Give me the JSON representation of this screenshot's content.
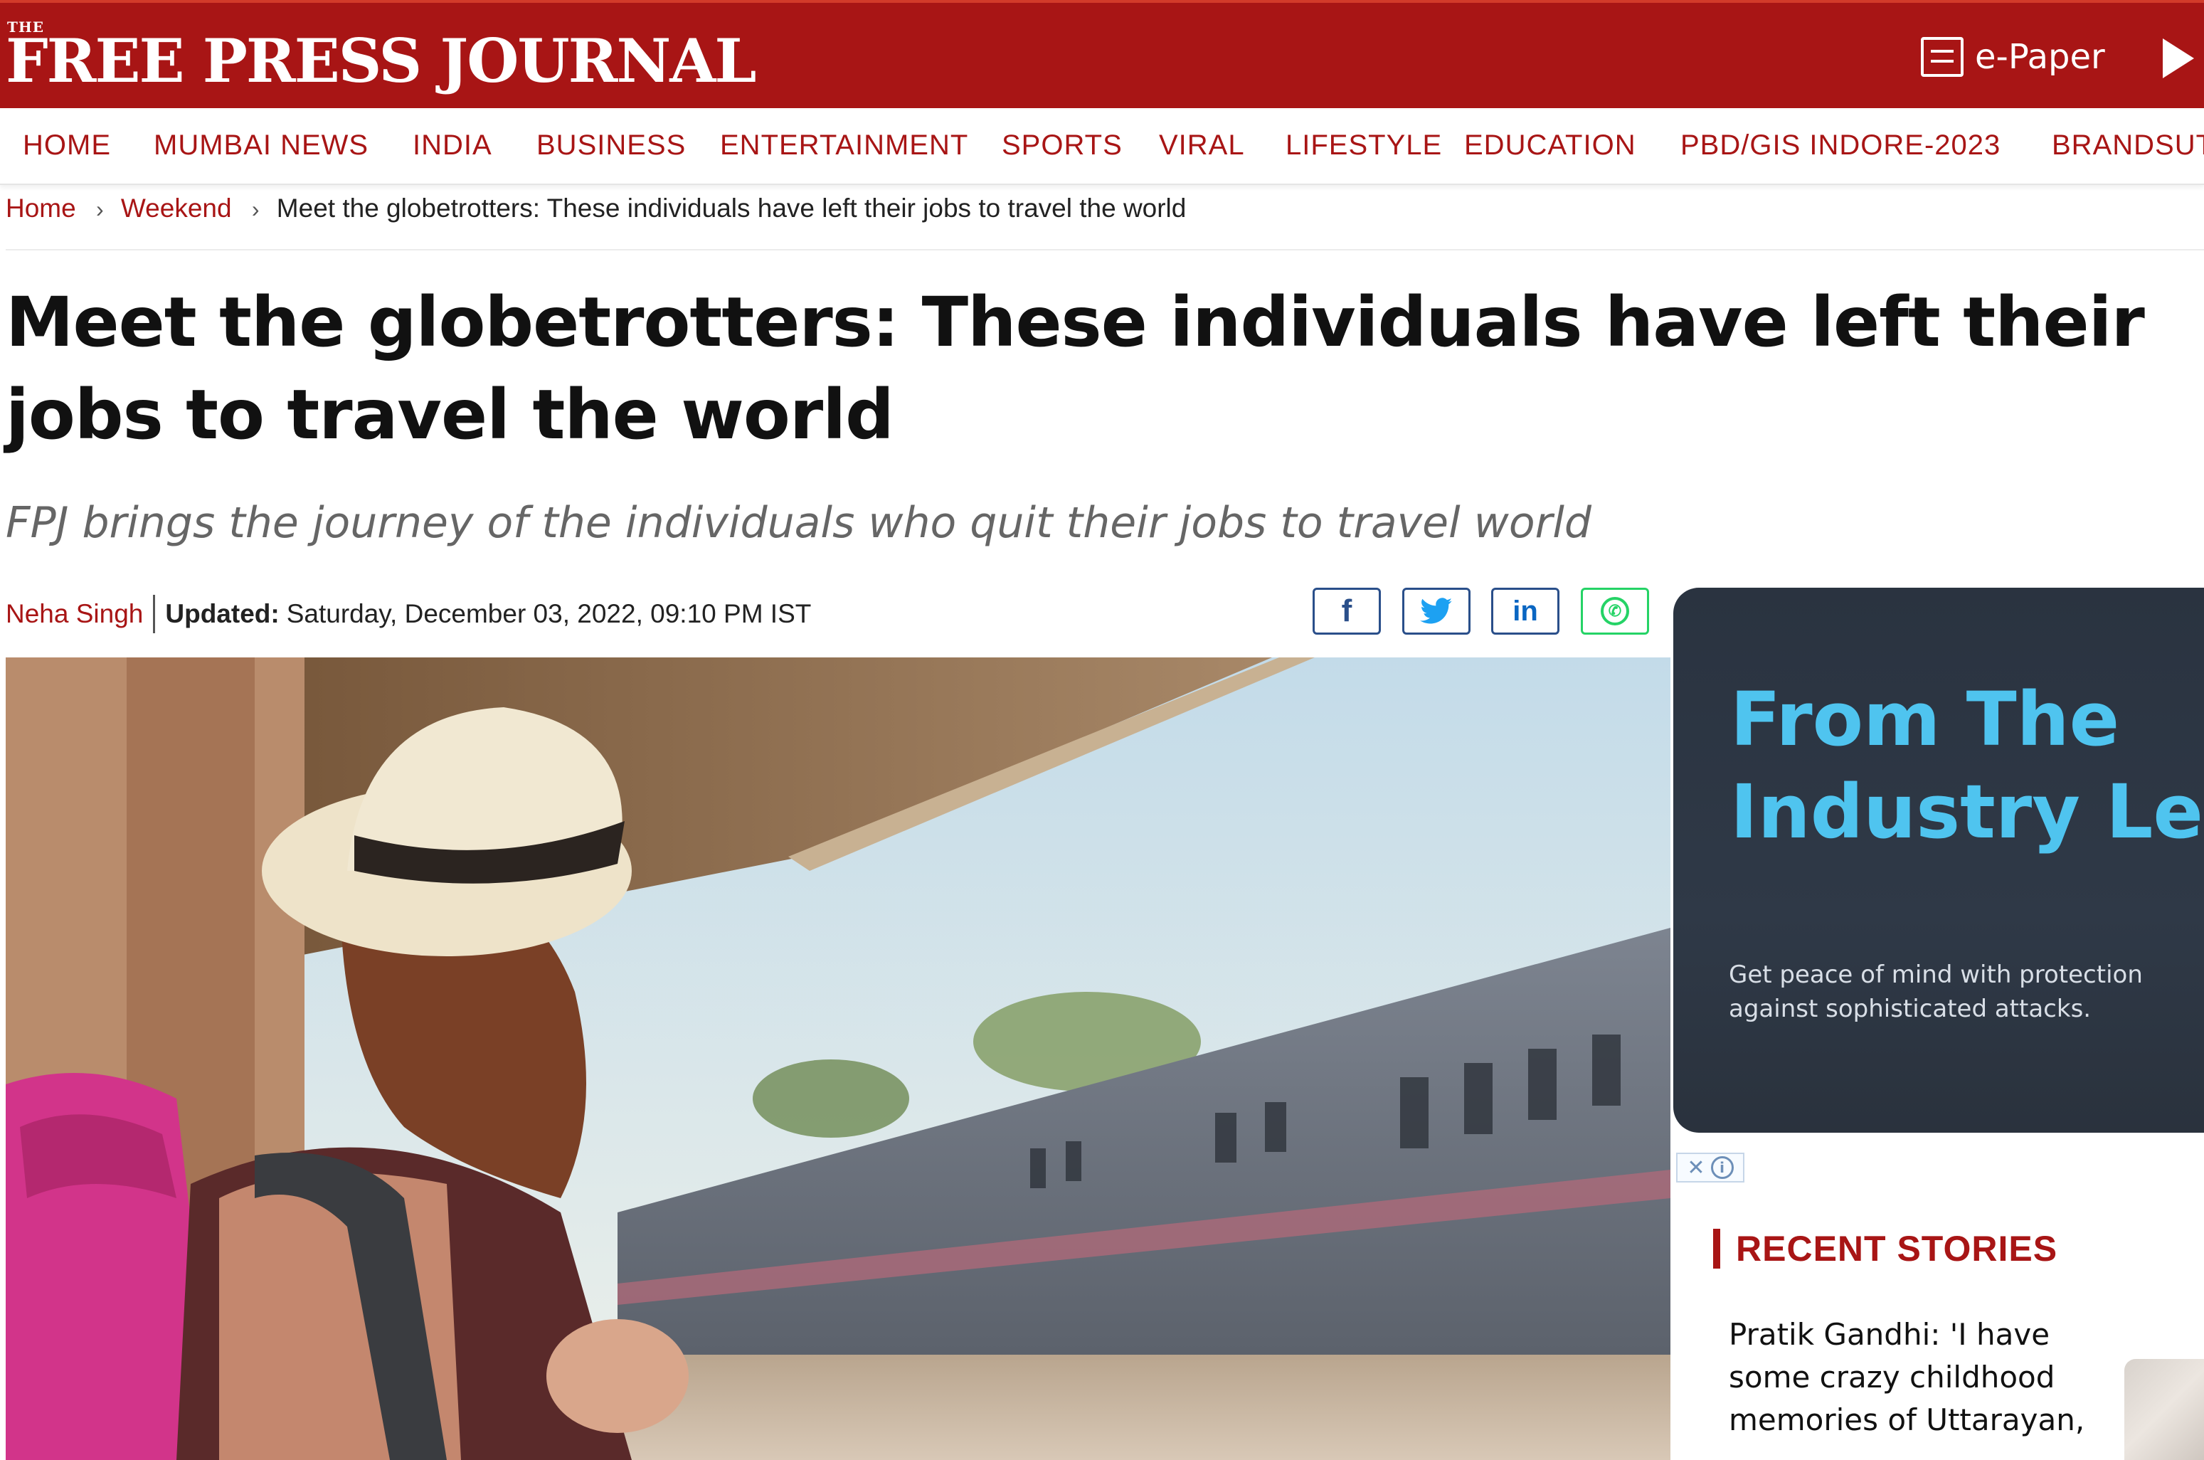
{
  "header": {
    "logo_small": "THE",
    "logo": "FREE PRESS JOURNAL",
    "epaper_label": "e-Paper"
  },
  "nav": {
    "items": [
      {
        "label": "HOME"
      },
      {
        "label": "MUMBAI NEWS"
      },
      {
        "label": "INDIA"
      },
      {
        "label": "BUSINESS"
      },
      {
        "label": "ENTERTAINMENT"
      },
      {
        "label": "SPORTS"
      },
      {
        "label": "VIRAL"
      },
      {
        "label": "LIFESTYLE"
      },
      {
        "label": "EDUCATION"
      },
      {
        "label": "PBD/GIS INDORE-2023"
      },
      {
        "label": "BRANDSUTRA"
      }
    ]
  },
  "breadcrumb": {
    "home": "Home",
    "section": "Weekend",
    "current": "Meet the globetrotters: These individuals have left their jobs to travel the world",
    "separator": "›"
  },
  "article": {
    "headline": "Meet the globetrotters: These individuals have left their jobs to travel the world",
    "subtitle": "FPJ brings the journey of the individuals who quit their jobs to travel world",
    "author": "Neha Singh",
    "updated_label": "Updated:",
    "updated_value": "Saturday, December 03, 2022, 09:10 PM IST"
  },
  "share": {
    "facebook": "f",
    "linkedin": "in"
  },
  "ad": {
    "title_line1": "From The",
    "title_line2": "Industry Lea",
    "body": "Get peace of mind with protection against sophisticated attacks.",
    "close_symbol": "✕",
    "info_symbol": "i"
  },
  "sidebar": {
    "recent_title": "RECENT STORIES",
    "stories": [
      {
        "title": "Pratik Gandhi: 'I have some crazy childhood memories of Uttarayan,"
      }
    ]
  },
  "colors": {
    "brand_red": "#a81515",
    "ad_bg": "#2a3340",
    "ad_title": "#4fc4ef",
    "whatsapp": "#25d366",
    "twitter": "#1da1f2"
  }
}
